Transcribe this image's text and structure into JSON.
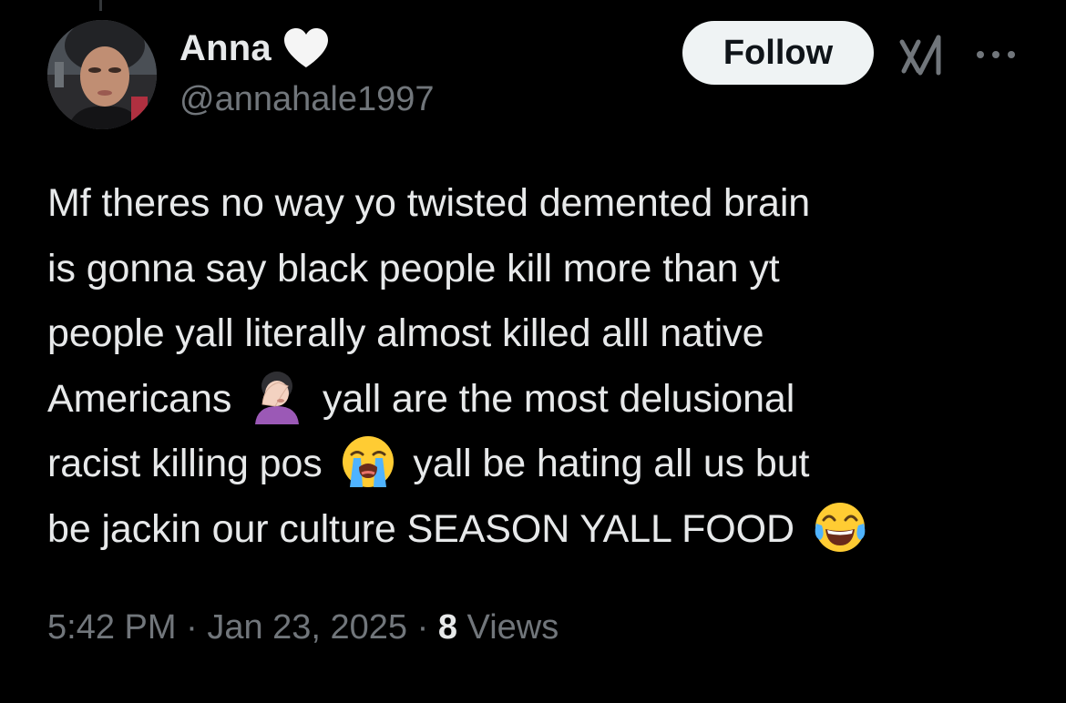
{
  "author": {
    "display_name": "Anna",
    "handle": "@annahale1997",
    "badge_icon": "white-heart-icon",
    "avatar_icon": "profile-photo-icon"
  },
  "actions": {
    "follow_label": "Follow",
    "grok_icon": "grok-icon",
    "more_icon": "more-horizontal-icon"
  },
  "tweet": {
    "lines": [
      "Mf theres no way yo twisted demented brain",
      "is gonna say black people kill more than yt",
      "people yall literally almost killed alll native",
      {
        "before": "Americans",
        "emoji": "woman-facepalming",
        "after": "yall are the most delusional"
      },
      {
        "before": "racist killing pos",
        "emoji": "loudly-crying-face",
        "after": "yall be hating all us but"
      },
      {
        "before": "be jackin our culture SEASON YALL FOOD",
        "emoji": "face-with-tears-of-joy",
        "after": ""
      }
    ]
  },
  "meta": {
    "time": "5:42 PM",
    "separator": "·",
    "date": "Jan 23, 2025",
    "views_count": "8",
    "views_label": "Views"
  },
  "colors": {
    "background": "#000000",
    "primary_text": "#e7e9ea",
    "secondary_text": "#71767b",
    "follow_bg": "#eff3f4",
    "follow_text": "#0f1419"
  }
}
